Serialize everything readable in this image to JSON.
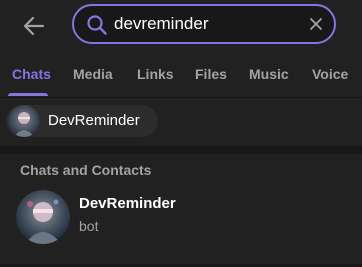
{
  "search": {
    "value": "devreminder"
  },
  "tabs": [
    {
      "label": "Chats",
      "active": true
    },
    {
      "label": "Media",
      "active": false
    },
    {
      "label": "Links",
      "active": false
    },
    {
      "label": "Files",
      "active": false
    },
    {
      "label": "Music",
      "active": false
    },
    {
      "label": "Voice",
      "active": false
    }
  ],
  "recent_chip": {
    "label": "DevReminder"
  },
  "results_section": {
    "title": "Chats and Contacts",
    "items": [
      {
        "name": "DevReminder",
        "subtitle": "bot"
      }
    ]
  },
  "colors": {
    "accent": "#8774e1",
    "background": "#212121",
    "text_secondary": "#a3a3a3"
  },
  "icons": {
    "back": "arrow-left-icon",
    "search": "search-icon",
    "clear": "close-icon"
  }
}
